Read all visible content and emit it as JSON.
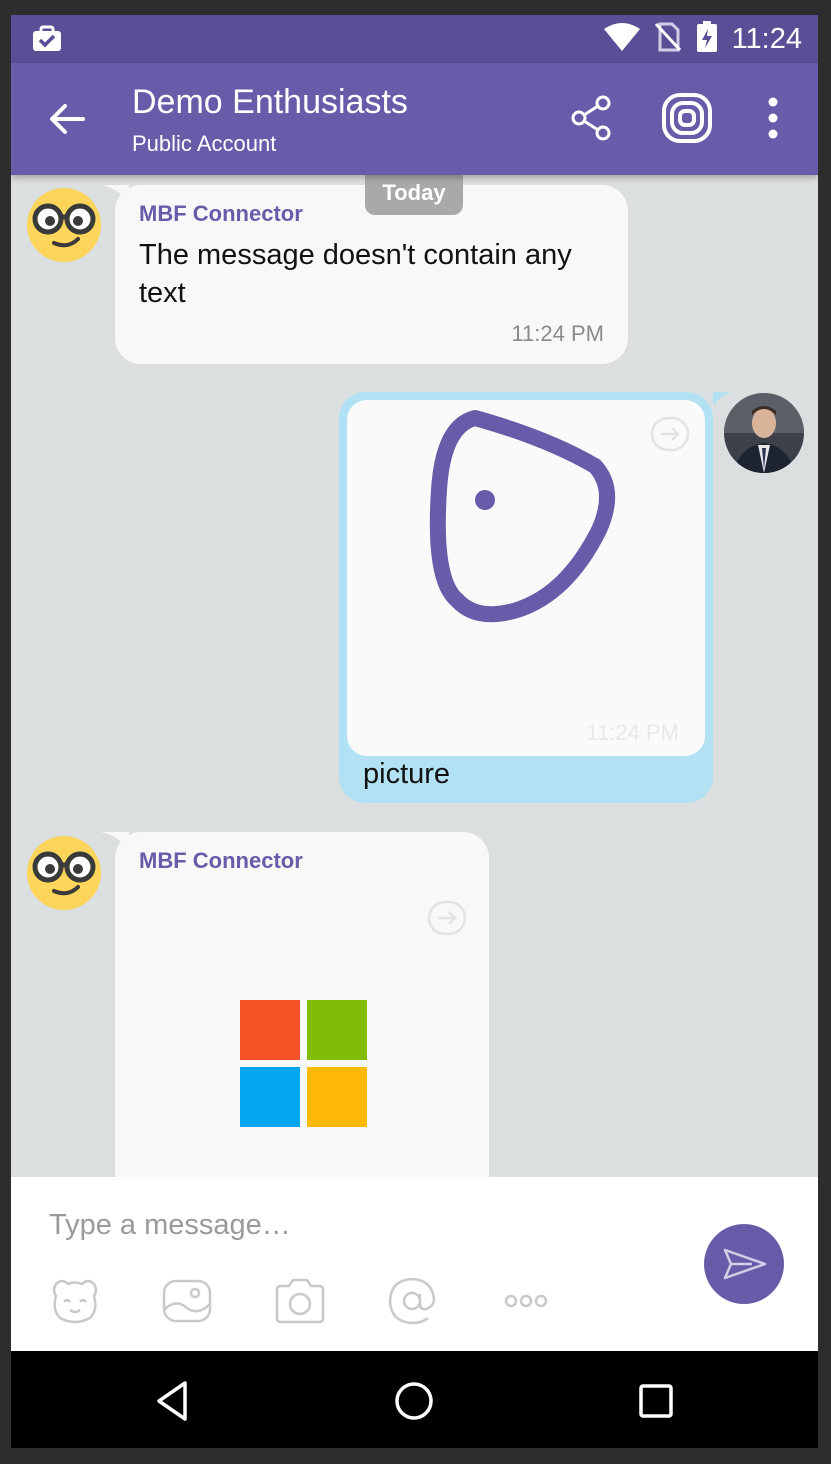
{
  "status_bar": {
    "time": "11:24"
  },
  "header": {
    "title": "Demo Enthusiasts",
    "subtitle": "Public Account"
  },
  "chat": {
    "date_divider": "Today",
    "messages": [
      {
        "direction": "incoming",
        "sender": "MBF Connector",
        "text": "The message doesn't contain any text",
        "time": "11:24 PM",
        "avatar": "nerd-face-emoji"
      },
      {
        "direction": "outgoing",
        "type": "picture",
        "caption": "picture",
        "time": "11:24 PM",
        "avatar": "user-photo"
      },
      {
        "direction": "incoming",
        "sender": "MBF Connector",
        "type": "image",
        "image": "microsoft-logo",
        "avatar": "nerd-face-emoji"
      }
    ]
  },
  "composer": {
    "placeholder": "Type a message…",
    "tools": [
      "sticker-icon",
      "gallery-icon",
      "camera-icon",
      "mention-icon",
      "more-icon"
    ]
  },
  "colors": {
    "status_bar": "#5a4f97",
    "app_bar": "#675ca9",
    "accent": "#675ca9",
    "outgoing_bubble": "#b1e1f3",
    "incoming_bubble": "#f8f8f8",
    "chat_background": "#dcdfdf"
  }
}
